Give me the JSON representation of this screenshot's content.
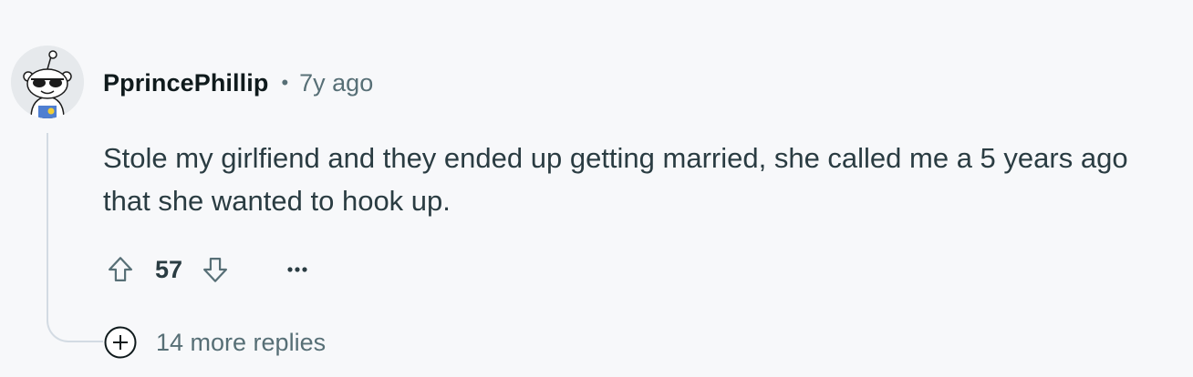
{
  "comment": {
    "author": "PprincePhillip",
    "separator": "•",
    "timestamp": "7y ago",
    "body": "Stole my girlfiend and they ended up getting married, she called me a 5 years ago that she wanted to hook up.",
    "score": "57",
    "more_replies_label": "14 more replies"
  },
  "icons": {
    "avatar": "snoo-avatar-with-sunglasses",
    "upvote": "arrow-up-outline-icon",
    "downvote": "arrow-down-outline-icon",
    "more": "ellipsis-icon",
    "expand": "plus-circle-icon"
  },
  "colors": {
    "background": "#f7f8fa",
    "meta_text": "#576f76",
    "body_text": "#2a3c42",
    "thread_line": "#d3dbe3"
  }
}
